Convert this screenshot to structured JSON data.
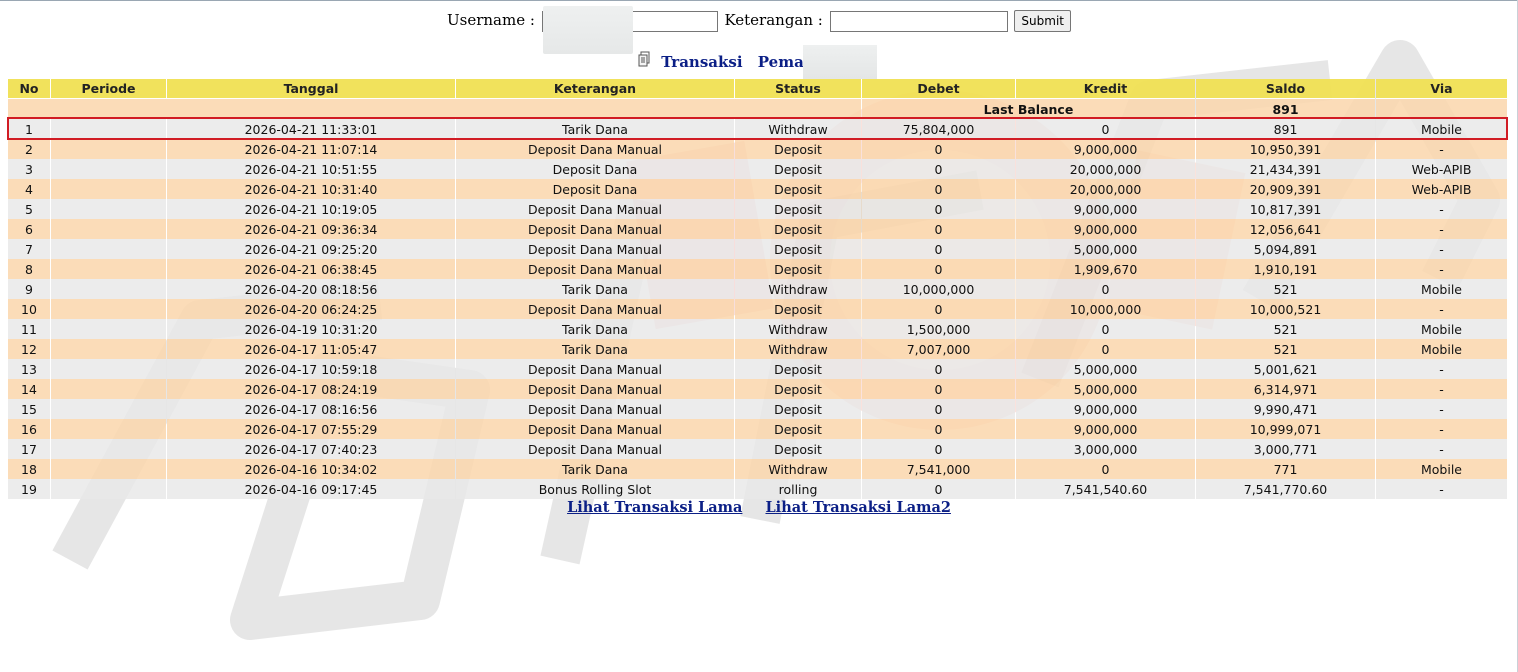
{
  "form": {
    "username_label": "Username :",
    "username_value": "",
    "keterangan_label": "Keterangan :",
    "keterangan_value": "",
    "submit_label": "Submit"
  },
  "title": {
    "transaksi": "Transaksi",
    "pemain": "Pemain :",
    "icon": "document-icon"
  },
  "table": {
    "headers": [
      "No",
      "Periode",
      "Tanggal",
      "Keterangan",
      "Status",
      "Debet",
      "Kredit",
      "Saldo",
      "Via"
    ],
    "last_balance_label": "Last Balance",
    "last_balance_value": "891",
    "rows": [
      {
        "no": "1",
        "periode": "",
        "tanggal": "2026-04-21 11:33:01",
        "keterangan": "Tarik Dana",
        "status": "Withdraw",
        "debet": "75,804,000",
        "kredit": "0",
        "saldo": "891",
        "via": "Mobile"
      },
      {
        "no": "2",
        "periode": "",
        "tanggal": "2026-04-21 11:07:14",
        "keterangan": "Deposit Dana Manual",
        "status": "Deposit",
        "debet": "0",
        "kredit": "9,000,000",
        "saldo": "10,950,391",
        "via": "-"
      },
      {
        "no": "3",
        "periode": "",
        "tanggal": "2026-04-21 10:51:55",
        "keterangan": "Deposit Dana",
        "status": "Deposit",
        "debet": "0",
        "kredit": "20,000,000",
        "saldo": "21,434,391",
        "via": "Web-APIB"
      },
      {
        "no": "4",
        "periode": "",
        "tanggal": "2026-04-21 10:31:40",
        "keterangan": "Deposit Dana",
        "status": "Deposit",
        "debet": "0",
        "kredit": "20,000,000",
        "saldo": "20,909,391",
        "via": "Web-APIB"
      },
      {
        "no": "5",
        "periode": "",
        "tanggal": "2026-04-21 10:19:05",
        "keterangan": "Deposit Dana Manual",
        "status": "Deposit",
        "debet": "0",
        "kredit": "9,000,000",
        "saldo": "10,817,391",
        "via": "-"
      },
      {
        "no": "6",
        "periode": "",
        "tanggal": "2026-04-21 09:36:34",
        "keterangan": "Deposit Dana Manual",
        "status": "Deposit",
        "debet": "0",
        "kredit": "9,000,000",
        "saldo": "12,056,641",
        "via": "-"
      },
      {
        "no": "7",
        "periode": "",
        "tanggal": "2026-04-21 09:25:20",
        "keterangan": "Deposit Dana Manual",
        "status": "Deposit",
        "debet": "0",
        "kredit": "5,000,000",
        "saldo": "5,094,891",
        "via": "-"
      },
      {
        "no": "8",
        "periode": "",
        "tanggal": "2026-04-21 06:38:45",
        "keterangan": "Deposit Dana Manual",
        "status": "Deposit",
        "debet": "0",
        "kredit": "1,909,670",
        "saldo": "1,910,191",
        "via": "-"
      },
      {
        "no": "9",
        "periode": "",
        "tanggal": "2026-04-20 08:18:56",
        "keterangan": "Tarik Dana",
        "status": "Withdraw",
        "debet": "10,000,000",
        "kredit": "0",
        "saldo": "521",
        "via": "Mobile"
      },
      {
        "no": "10",
        "periode": "",
        "tanggal": "2026-04-20 06:24:25",
        "keterangan": "Deposit Dana Manual",
        "status": "Deposit",
        "debet": "0",
        "kredit": "10,000,000",
        "saldo": "10,000,521",
        "via": "-"
      },
      {
        "no": "11",
        "periode": "",
        "tanggal": "2026-04-19 10:31:20",
        "keterangan": "Tarik Dana",
        "status": "Withdraw",
        "debet": "1,500,000",
        "kredit": "0",
        "saldo": "521",
        "via": "Mobile"
      },
      {
        "no": "12",
        "periode": "",
        "tanggal": "2026-04-17 11:05:47",
        "keterangan": "Tarik Dana",
        "status": "Withdraw",
        "debet": "7,007,000",
        "kredit": "0",
        "saldo": "521",
        "via": "Mobile"
      },
      {
        "no": "13",
        "periode": "",
        "tanggal": "2026-04-17 10:59:18",
        "keterangan": "Deposit Dana Manual",
        "status": "Deposit",
        "debet": "0",
        "kredit": "5,000,000",
        "saldo": "5,001,621",
        "via": "-"
      },
      {
        "no": "14",
        "periode": "",
        "tanggal": "2026-04-17 08:24:19",
        "keterangan": "Deposit Dana Manual",
        "status": "Deposit",
        "debet": "0",
        "kredit": "5,000,000",
        "saldo": "6,314,971",
        "via": "-"
      },
      {
        "no": "15",
        "periode": "",
        "tanggal": "2026-04-17 08:16:56",
        "keterangan": "Deposit Dana Manual",
        "status": "Deposit",
        "debet": "0",
        "kredit": "9,000,000",
        "saldo": "9,990,471",
        "via": "-"
      },
      {
        "no": "16",
        "periode": "",
        "tanggal": "2026-04-17 07:55:29",
        "keterangan": "Deposit Dana Manual",
        "status": "Deposit",
        "debet": "0",
        "kredit": "9,000,000",
        "saldo": "10,999,071",
        "via": "-"
      },
      {
        "no": "17",
        "periode": "",
        "tanggal": "2026-04-17 07:40:23",
        "keterangan": "Deposit Dana Manual",
        "status": "Deposit",
        "debet": "0",
        "kredit": "3,000,000",
        "saldo": "3,000,771",
        "via": "-"
      },
      {
        "no": "18",
        "periode": "",
        "tanggal": "2026-04-16 10:34:02",
        "keterangan": "Tarik Dana",
        "status": "Withdraw",
        "debet": "7,541,000",
        "kredit": "0",
        "saldo": "771",
        "via": "Mobile"
      },
      {
        "no": "19",
        "periode": "",
        "tanggal": "2026-04-16 09:17:45",
        "keterangan": "Bonus Rolling Slot",
        "status": "rolling",
        "debet": "0",
        "kredit": "7,541,540.60",
        "saldo": "7,541,770.60",
        "via": "-"
      }
    ]
  },
  "footer": {
    "link1": "Lihat Transaksi Lama",
    "link2": "Lihat Transaksi Lama2"
  },
  "colors": {
    "header_bg": "#f0e050",
    "row_odd": "#e8e8e8",
    "row_even": "#fad6ac",
    "status_red": "#c0171d",
    "money_blue": "#1c1ca8",
    "link_blue": "#0b1f86",
    "highlight_red": "#d11c24"
  }
}
